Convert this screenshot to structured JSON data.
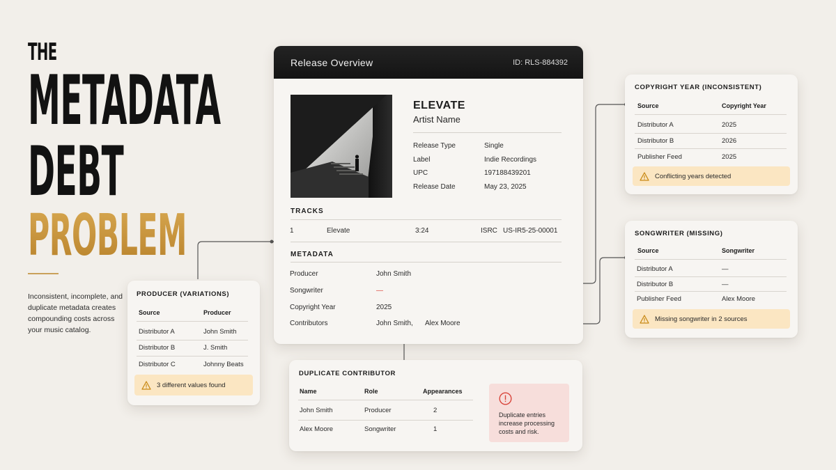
{
  "hero": {
    "line1": "THE",
    "line2": "METADATA",
    "line3": "DEBT",
    "line4": "PROBLEM",
    "description": "Inconsistent, incomplete, and duplicate metadata creates compounding costs across your music catalog."
  },
  "release": {
    "header_title": "Release Overview",
    "id_label": "ID: RLS-884392",
    "album_title": "ELEVATE",
    "artist": "Artist Name",
    "fields": [
      {
        "label": "Release Type",
        "value": "Single"
      },
      {
        "label": "Label",
        "value": "Indie Recordings"
      },
      {
        "label": "UPC",
        "value": "197188439201"
      },
      {
        "label": "Release Date",
        "value": "May 23, 2025"
      }
    ],
    "tracks_title": "TRACKS",
    "track": {
      "number": "1",
      "title": "Elevate",
      "duration": "3:24",
      "isrc_label": "ISRC",
      "isrc": "US-IR5-25-00001"
    },
    "metadata_title": "METADATA",
    "metadata": [
      {
        "label": "Producer",
        "value": "John Smith"
      },
      {
        "label": "Songwriter",
        "value": "—"
      },
      {
        "label": "Copyright Year",
        "value": "2025"
      }
    ],
    "contributors_label": "Contributors",
    "contributors": [
      "John Smith,",
      "Alex Moore"
    ]
  },
  "copyright_card": {
    "title": "COPYRIGHT YEAR (INCONSISTENT)",
    "col1": "Source",
    "col2": "Copyright Year",
    "rows": [
      {
        "source": "Distributor A",
        "value": "2025"
      },
      {
        "source": "Distributor B",
        "value": "2026"
      },
      {
        "source": "Publisher Feed",
        "value": "2025"
      }
    ],
    "warning": "Conflicting years detected"
  },
  "songwriter_card": {
    "title": "SONGWRITER (MISSING)",
    "col1": "Source",
    "col2": "Songwriter",
    "rows": [
      {
        "source": "Distributor A",
        "value": "—"
      },
      {
        "source": "Distributor B",
        "value": "—"
      },
      {
        "source": "Publisher Feed",
        "value": "Alex Moore"
      }
    ],
    "warning": "Missing songwriter in 2 sources"
  },
  "producer_card": {
    "title": "PRODUCER (VARIATIONS)",
    "col1": "Source",
    "col2": "Producer",
    "rows": [
      {
        "source": "Distributor A",
        "value": "John Smith"
      },
      {
        "source": "Distributor B",
        "value": "J. Smith"
      },
      {
        "source": "Distributor C",
        "value": "Johnny Beats"
      }
    ],
    "warning": "3 different values found"
  },
  "duplicate_card": {
    "title": "DUPLICATE CONTRIBUTOR",
    "col1": "Name",
    "col2": "Role",
    "col3": "Appearances",
    "rows": [
      {
        "name": "John Smith",
        "role": "Producer",
        "count": "2"
      },
      {
        "name": "Alex Moore",
        "role": "Songwriter",
        "count": "1"
      }
    ],
    "alert": "Duplicate entries increase processing costs and risk."
  },
  "colors": {
    "accent_gold": "#c08f3a",
    "warning_bg": "#fbe6c2",
    "alert_bg": "#f7dedb",
    "alert_red": "#d9453b",
    "header_dark": "#1a1a1a"
  }
}
